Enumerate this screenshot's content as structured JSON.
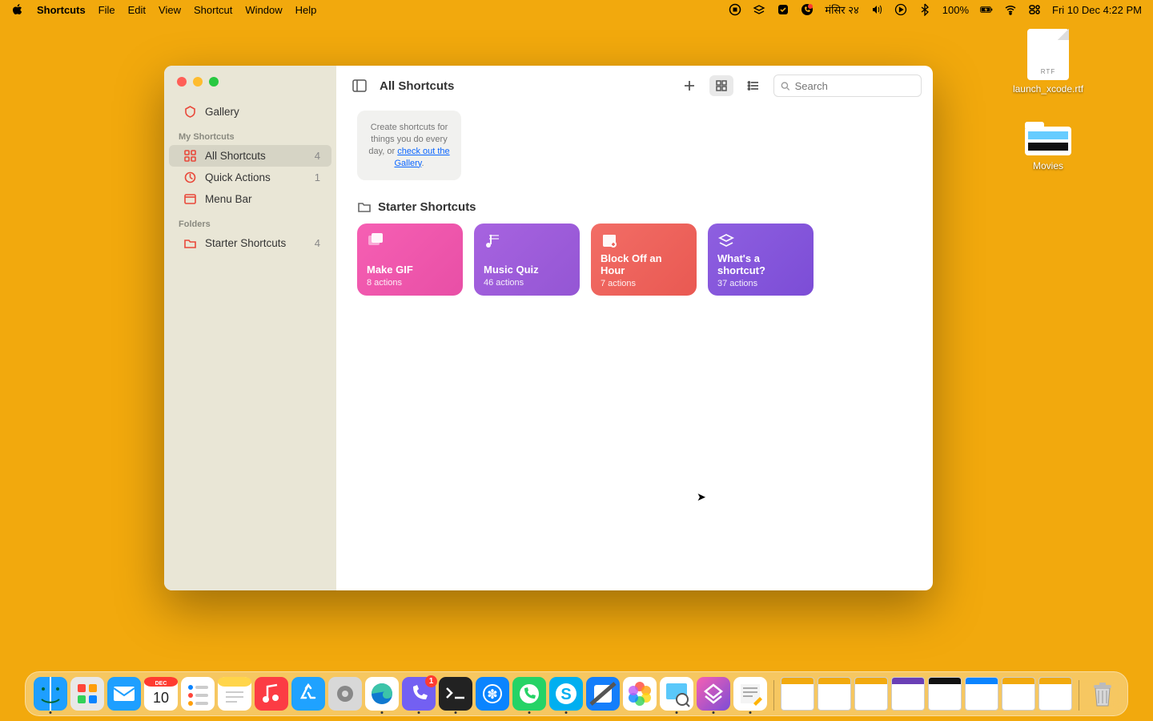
{
  "menubar": {
    "app": "Shortcuts",
    "items": [
      "File",
      "Edit",
      "View",
      "Shortcut",
      "Window",
      "Help"
    ],
    "calendar": "मंसिर २४",
    "battery": "100%",
    "clock": "Fri 10 Dec  4:22 PM"
  },
  "desktop": {
    "file1": "launch_xcode.rtf",
    "folder1": "Movies"
  },
  "window": {
    "title": "All Shortcuts",
    "search_placeholder": "Search",
    "sidebar": {
      "gallery": "Gallery",
      "header1": "My Shortcuts",
      "items": [
        {
          "label": "All Shortcuts",
          "count": "4"
        },
        {
          "label": "Quick Actions",
          "count": "1"
        },
        {
          "label": "Menu Bar",
          "count": ""
        }
      ],
      "header2": "Folders",
      "folders": [
        {
          "label": "Starter Shortcuts",
          "count": "4"
        }
      ]
    },
    "hint_pre": "Create shortcuts for things you do every day, or ",
    "hint_link": "check out the Gallery",
    "hint_post": ".",
    "section": "Starter Shortcuts",
    "cards": [
      {
        "title": "Make GIF",
        "sub": "8 actions",
        "cls": "c-pink",
        "icon": "photos"
      },
      {
        "title": "Music Quiz",
        "sub": "46 actions",
        "cls": "c-purple",
        "icon": "music"
      },
      {
        "title": "Block Off an Hour",
        "sub": "7 actions",
        "cls": "c-red",
        "icon": "cal"
      },
      {
        "title": "What's a shortcut?",
        "sub": "37 actions",
        "cls": "c-violet",
        "icon": "stack"
      }
    ]
  },
  "dock": {
    "apps": [
      {
        "name": "finder",
        "bg": "linear-gradient(#38B7FF,#0A84FF)",
        "dot": true
      },
      {
        "name": "launchpad",
        "bg": "#E5E5E5",
        "dot": false
      },
      {
        "name": "mail",
        "bg": "linear-gradient(#5AC8FA,#0A84FF)",
        "dot": false
      },
      {
        "name": "calendar",
        "bg": "#fff",
        "dot": false,
        "date_mon": "DEC",
        "date_d": "10"
      },
      {
        "name": "reminders",
        "bg": "#fff",
        "dot": false
      },
      {
        "name": "notes",
        "bg": "linear-gradient(#FFE9A8,#fff)",
        "dot": false
      },
      {
        "name": "music",
        "bg": "linear-gradient(#FC3C44,#F9243B)",
        "dot": false
      },
      {
        "name": "appstore",
        "bg": "linear-gradient(#1FA2FF,#0A84FF)",
        "dot": false
      },
      {
        "name": "settings",
        "bg": "#D8D8D8",
        "dot": false
      },
      {
        "name": "edge",
        "bg": "#fff",
        "dot": true
      },
      {
        "name": "viber",
        "bg": "#7360F2",
        "dot": true,
        "badge": "1"
      },
      {
        "name": "terminal",
        "bg": "#222",
        "dot": true
      },
      {
        "name": "sfsym",
        "bg": "#0A84FF",
        "dot": false
      },
      {
        "name": "whatsapp",
        "bg": "#25D366",
        "dot": true
      },
      {
        "name": "skype",
        "bg": "#00AFF0",
        "dot": true
      },
      {
        "name": "xcode",
        "bg": "#147EFB",
        "dot": false
      },
      {
        "name": "photos",
        "bg": "#fff",
        "dot": false
      },
      {
        "name": "preview",
        "bg": "#fff",
        "dot": true
      },
      {
        "name": "shortcuts",
        "bg": "linear-gradient(135deg,#F65FB3,#7C4DD6)",
        "dot": true
      },
      {
        "name": "textedit",
        "bg": "#fff",
        "dot": true
      }
    ],
    "minis": [
      {
        "bar": "#F2A90D"
      },
      {
        "bar": "#F2A90D"
      },
      {
        "bar": "#F2A90D"
      },
      {
        "bar": "#6A3FB5"
      },
      {
        "bar": "#111"
      },
      {
        "bar": "#0A84FF"
      },
      {
        "bar": "#F2A90D"
      },
      {
        "bar": "#F2A90D"
      }
    ]
  }
}
